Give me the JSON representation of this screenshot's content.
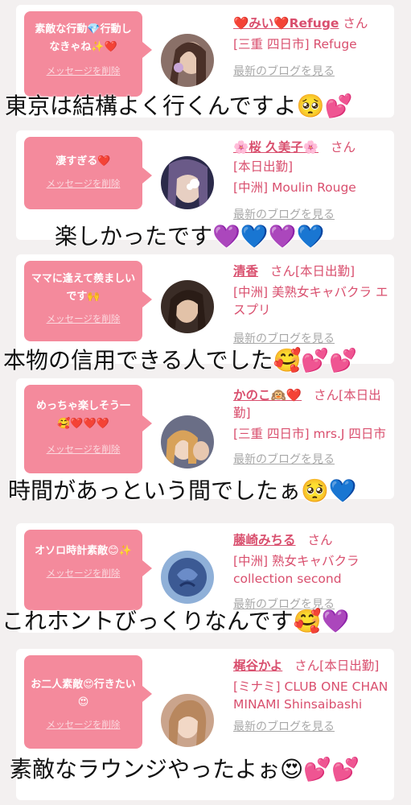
{
  "messages": [
    {
      "bubble_text": "素敵な行動💎行動しなきゃね✨❤️",
      "delete_label": "メッセージを削除",
      "name": "❤️みい❤️Refuge",
      "honorific": "さん",
      "shop": "[三重 四日市] Refuge",
      "blog_link": "最新のブログを見る",
      "caption": "東京は結構よく行くんですよ🥺💕"
    },
    {
      "bubble_text": "凄すぎる❤️",
      "delete_label": "メッセージを削除",
      "name": "🌸桜 久美子🌸",
      "honorific": "さん",
      "status": "[本日出勤]",
      "shop": "[中洲] Moulin Rouge",
      "blog_link": "最新のブログを見る",
      "caption": "楽しかったです💜💙💜💙"
    },
    {
      "bubble_text": "ママに逢えて羨ましいです🙌",
      "delete_label": "メッセージを削除",
      "name": "清香",
      "honorific": "さん[本日出勤]",
      "shop": "[中洲] 美熟女キャバクラ エスプリ",
      "blog_link": "最新のブログを見る",
      "caption": "本物の信用できる人でした🥰💕💕"
    },
    {
      "bubble_text": "めっちゃ楽しそう一🥰❤️❤️❤️",
      "delete_label": "メッセージを削除",
      "name": "かのこ🙉❤️",
      "honorific": "さん[本日出勤]",
      "shop": "[三重 四日市] mrs.J 四日市",
      "blog_link": "最新のブログを見る",
      "caption": "時間があっという間でしたぁ🥺💙"
    },
    {
      "bubble_text": "オソロ時計素敵😊✨",
      "delete_label": "メッセージを削除",
      "name": "藤崎みちる",
      "honorific": "さん",
      "shop": "[中洲] 熟女キャバクラ collection second",
      "blog_link": "最新のブログを見る",
      "caption": "これホントびっくりなんです🥰💜"
    },
    {
      "bubble_text": "お二人素敵😍行きたい😍",
      "delete_label": "メッセージを削除",
      "name": "梶谷かよ",
      "honorific": "さん[本日出勤]",
      "shop": "[ミナミ] CLUB ONE CHAN MINAMI Shinsaibashi",
      "blog_link": "最新のブログを見る",
      "caption": "素敵なラウンジやったよぉ😍💕💕"
    }
  ],
  "colors": {
    "bubble": "#f48a9c",
    "name": "#d94f6e",
    "blog_link": "#a8a8a8",
    "background": "#f3f0f0"
  }
}
